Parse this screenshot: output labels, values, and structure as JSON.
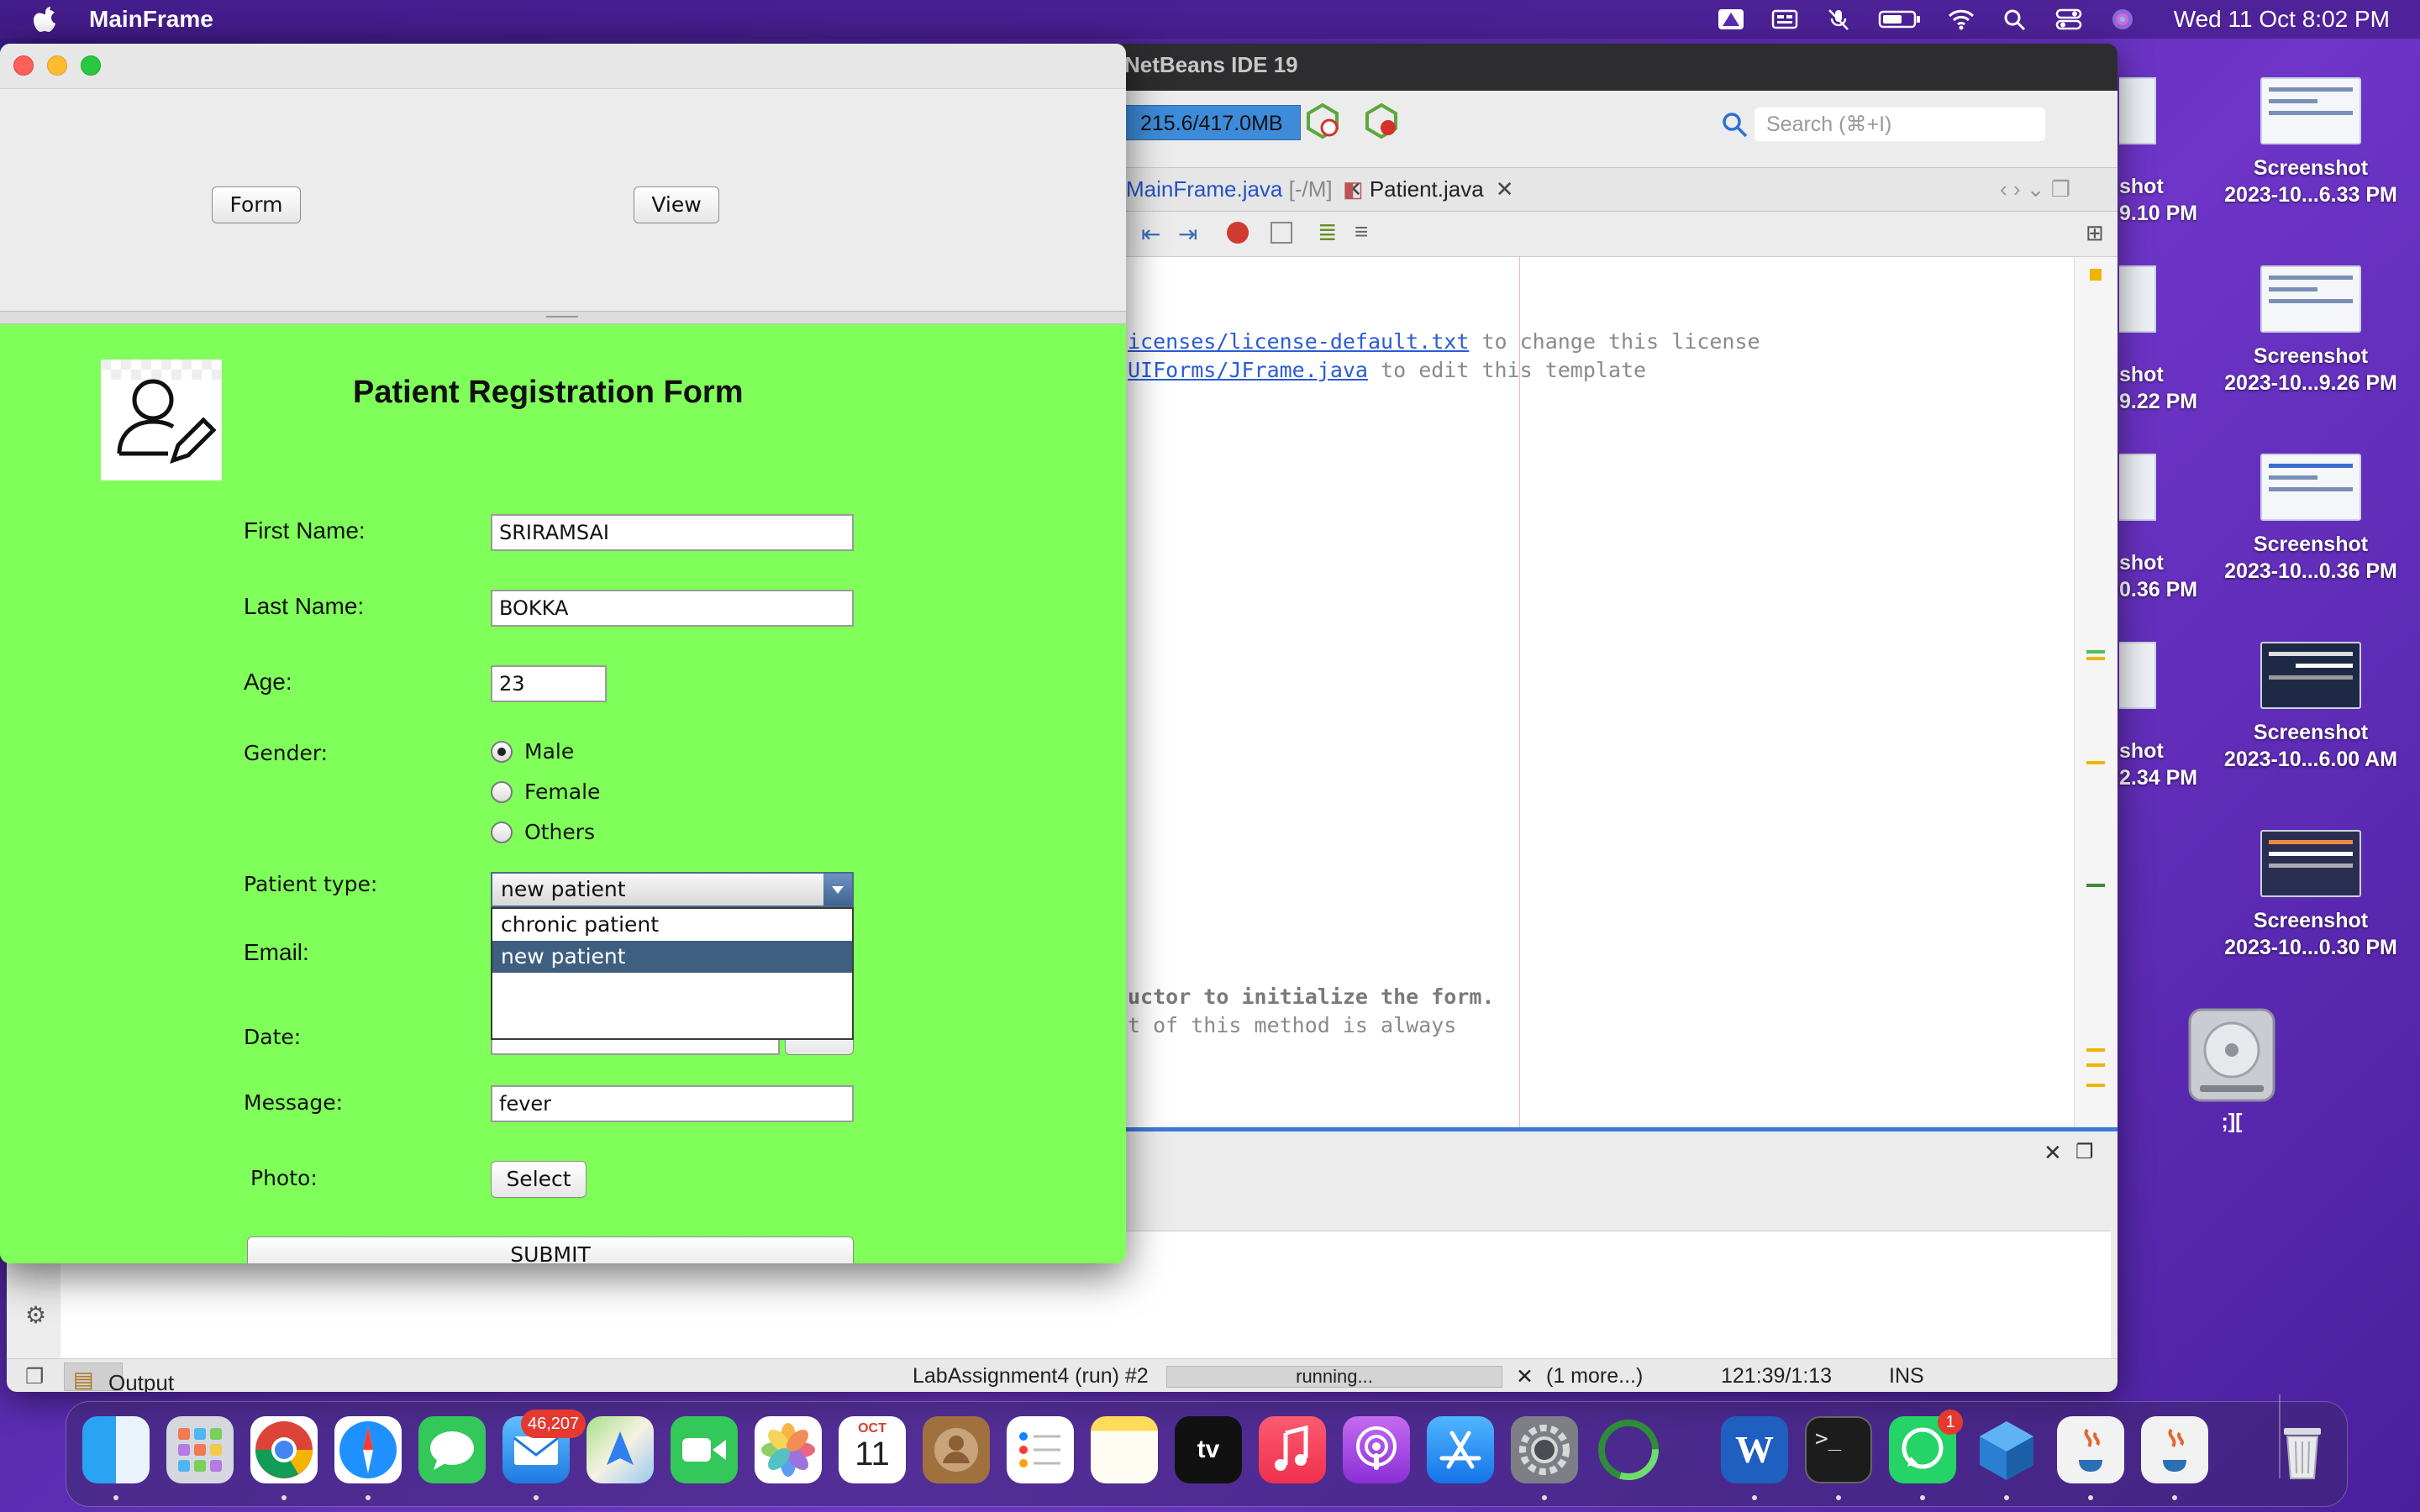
{
  "menubar": {
    "app_name": "MainFrame",
    "clock": "Wed 11 Oct  8:02 PM",
    "icons": [
      "apple-icon",
      "google-drive-icon",
      "input-menu-icon",
      "mic-muted-icon",
      "battery-icon",
      "wifi-icon",
      "spotlight-icon",
      "control-center-icon",
      "siri-icon"
    ]
  },
  "desktop": {
    "items": [
      {
        "line1": "Screenshot",
        "line2": "2023-10...6.33 PM"
      },
      {
        "line1": "Screenshot",
        "line2": "2023-10...9.26 PM"
      },
      {
        "line1": "Screenshot",
        "line2": "2023-10...0.36 PM"
      },
      {
        "line1": "Screenshot",
        "line2": "2023-10...6.00 AM"
      },
      {
        "line1": "Screenshot",
        "line2": "2023-10...0.30 PM"
      }
    ],
    "partial_items": [
      {
        "line1": "shot",
        "line2": "9.10 PM"
      },
      {
        "line1": "shot",
        "line2": "9.22 PM"
      },
      {
        "line1": "shot",
        "line2": "0.36 PM"
      },
      {
        "line1": "shot",
        "line2": "2.34 PM"
      }
    ],
    "disk_label": ";]["
  },
  "netbeans": {
    "title": "NetBeans IDE 19",
    "memory": "215.6/417.0MB",
    "search_placeholder": "Search (⌘+I)",
    "tabs": [
      {
        "label": "MainFrame.java",
        "suffix": "[-/M]"
      },
      {
        "label": "Patient.java",
        "suffix": ""
      }
    ],
    "code": {
      "line1_link": "icenses/license-default.txt",
      "line1_rest": " to change this license",
      "line2_link": "UIForms/JFrame.java",
      "line2_rest": " to edit this template",
      "line3": "uctor to initialize the form.",
      "line4": "t of this method is always"
    },
    "status": {
      "output_tab": "Output",
      "run_label": "LabAssignment4 (run) #2",
      "progress": "running...",
      "more": "(1 more...)",
      "position": "121:39/1:13",
      "mode": "INS"
    }
  },
  "mainframe": {
    "title": "",
    "top_buttons": {
      "form": "Form",
      "view": "View"
    },
    "form": {
      "heading": "Patient Registration Form",
      "first_name_label": "First Name:",
      "first_name_value": "SRIRAMSAI",
      "last_name_label": "Last Name:",
      "last_name_value": "BOKKA",
      "age_label": "Age:",
      "age_value": "23",
      "gender_label": "Gender:",
      "gender_options": [
        "Male",
        "Female",
        "Others"
      ],
      "gender_selected": "Male",
      "patient_type_label": "Patient type:",
      "patient_type_value": "new patient",
      "patient_type_options": [
        "chronic patient",
        "new patient"
      ],
      "email_label": "Email:",
      "date_label": "Date:",
      "message_label": "Message:",
      "message_value": "fever",
      "photo_label": "Photo:",
      "select_button": "Select",
      "submit_button": "SUBMIT"
    }
  },
  "dock": {
    "apps": [
      "Finder",
      "Launchpad",
      "Chrome",
      "Safari",
      "Messages",
      "Mail",
      "Maps",
      "FaceTime",
      "Photos",
      "Calendar",
      "Contacts",
      "Reminders",
      "Notes",
      "TV",
      "Music",
      "Podcasts",
      "App Store",
      "System Settings",
      "Activity",
      "Word",
      "Terminal",
      "WhatsApp",
      "NetBeans",
      "Java",
      "Java",
      "Trash"
    ],
    "mail_badge": "46,207",
    "whatsapp_badge": "1",
    "calendar_month": "OCT",
    "calendar_day": "11",
    "tv_label": "tv"
  }
}
